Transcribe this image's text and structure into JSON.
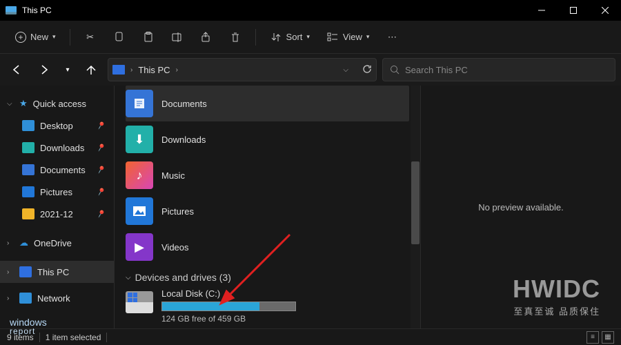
{
  "titlebar": {
    "title": "This PC"
  },
  "toolbar": {
    "new_label": "New",
    "sort_label": "Sort",
    "view_label": "View"
  },
  "address": {
    "location": "This PC"
  },
  "search": {
    "placeholder": "Search This PC"
  },
  "sidebar": {
    "quick_access": "Quick access",
    "desktop": "Desktop",
    "downloads": "Downloads",
    "documents": "Documents",
    "pictures": "Pictures",
    "folder_2021_12": "2021-12",
    "onedrive": "OneDrive",
    "this_pc": "This PC",
    "network": "Network"
  },
  "folders": {
    "documents": "Documents",
    "downloads": "Downloads",
    "music": "Music",
    "pictures": "Pictures",
    "videos": "Videos"
  },
  "devices_header": "Devices and drives (3)",
  "drive": {
    "name": "Local Disk (C:)",
    "free_text": "124 GB free of 459 GB",
    "fill_pct": 73
  },
  "preview": {
    "empty_text": "No preview available."
  },
  "statusbar": {
    "items": "9 items",
    "selected": "1 item selected"
  },
  "watermarks": {
    "hwidc": "HWIDC",
    "cn": "至真至诚 品质保住",
    "winreport1": "windows",
    "winreport2": "report"
  }
}
